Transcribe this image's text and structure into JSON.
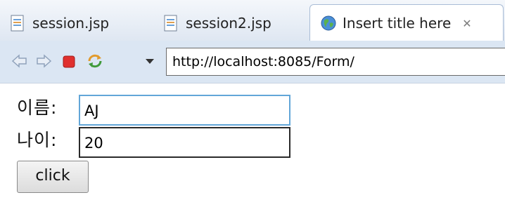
{
  "tabs": [
    {
      "label": "session.jsp",
      "icon": "jsp-file-icon"
    },
    {
      "label": "session2.jsp",
      "icon": "jsp-file-icon"
    },
    {
      "label": "Insert title here",
      "icon": "globe-icon",
      "close": "✕"
    }
  ],
  "toolbar": {
    "url": "http://localhost:8085/Form/",
    "back_icon": "back-arrow-icon",
    "forward_icon": "forward-arrow-icon",
    "stop_icon": "stop-icon",
    "refresh_icon": "refresh-icon",
    "menu_icon": "dropdown-arrow-icon"
  },
  "form": {
    "name_label": "이름:",
    "name_value": "AJ",
    "age_label": "나이:",
    "age_value": "20",
    "submit_label": "click"
  },
  "colors": {
    "focus_border": "#62a6d8",
    "stop_red": "#e0302e",
    "nav_bg": "#dbe6f3"
  }
}
